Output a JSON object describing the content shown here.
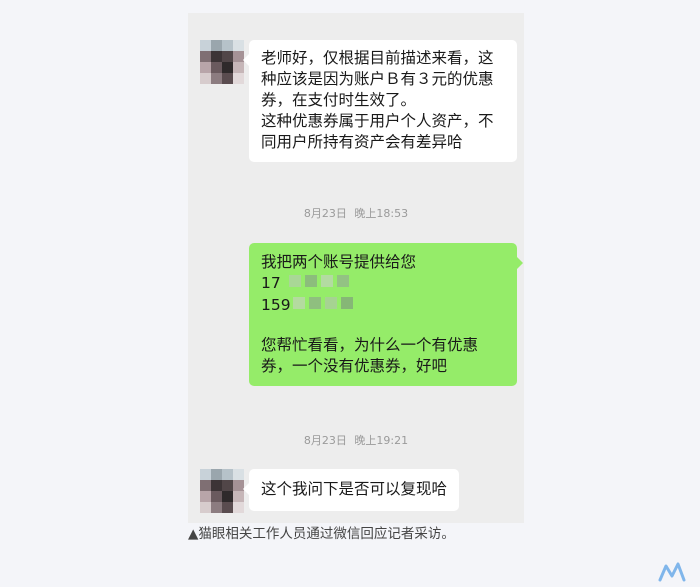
{
  "messages": [
    {
      "side": "left",
      "lines": [
        "老师好，仅根据目前描述来看，这种应该是因为账户Ｂ有３元的优惠券，在支付时生效了。",
        "这种优惠券属于用户个人资产，不同用户所持有资产会有差异哈"
      ]
    },
    {
      "side": "right",
      "intro": "我把两个账号提供给您",
      "accounts": [
        "17",
        "159"
      ],
      "question": "您帮忙看看，为什么一个有优惠券，一个没有优惠券，好吧"
    },
    {
      "side": "left",
      "lines": [
        "这个我问下是否可以复现哈"
      ]
    }
  ],
  "timestamps": [
    {
      "date": "8月23日",
      "time": "晚上18:53"
    },
    {
      "date": "8月23日",
      "time": "晚上19:21"
    }
  ],
  "caption": "▲猫眼相关工作人员通过微信回应记者采访。",
  "colors": {
    "chat_bg": "#ededed",
    "page_bg": "#f4f5f9",
    "sent_bubble": "#95ec69",
    "received_bubble": "#ffffff",
    "timestamp_text": "#9a9a9a"
  },
  "icons": {
    "avatar": "pixelated-avatar",
    "watermark": "blue-watermark-logo"
  }
}
